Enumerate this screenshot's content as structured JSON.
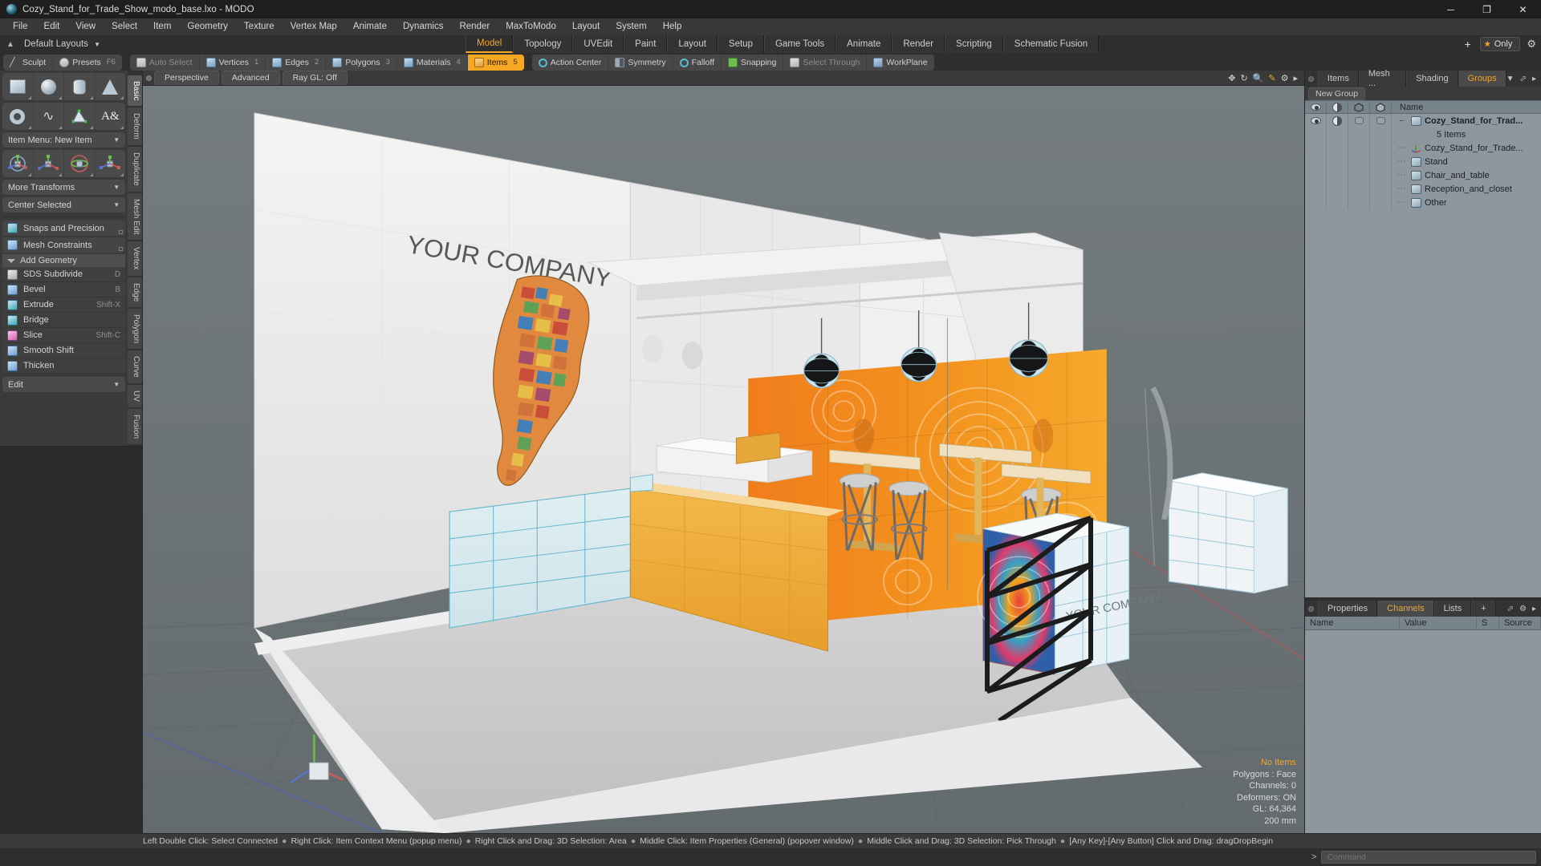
{
  "window": {
    "title": "Cozy_Stand_for_Trade_Show_modo_base.lxo - MODO",
    "app_icon": "modo-icon",
    "controls": {
      "minimize": "─",
      "maximize": "❐",
      "close": "✕"
    }
  },
  "menubar": {
    "items": [
      "File",
      "Edit",
      "View",
      "Select",
      "Item",
      "Geometry",
      "Texture",
      "Vertex Map",
      "Animate",
      "Dynamics",
      "Render",
      "MaxToModo",
      "Layout",
      "System",
      "Help"
    ]
  },
  "layoutbar": {
    "default_layouts": "Default Layouts",
    "tabs": [
      {
        "label": "Model",
        "active": true
      },
      {
        "label": "Topology",
        "active": false
      },
      {
        "label": "UVEdit",
        "active": false
      },
      {
        "label": "Paint",
        "active": false
      },
      {
        "label": "Layout",
        "active": false
      },
      {
        "label": "Setup",
        "active": false
      },
      {
        "label": "Game Tools",
        "active": false
      },
      {
        "label": "Animate",
        "active": false
      },
      {
        "label": "Render",
        "active": false
      },
      {
        "label": "Scripting",
        "active": false
      },
      {
        "label": "Schematic Fusion",
        "active": false
      }
    ],
    "add_tab": "+",
    "only_label": "Only",
    "gear": "gear-icon"
  },
  "modestrip": {
    "group_left": [
      {
        "label": "Sculpt",
        "key": "",
        "icon": "brush-icon",
        "dim": false,
        "active": false
      },
      {
        "label": "Presets",
        "key": "F6",
        "icon": "presets-icon",
        "dim": false,
        "active": false
      }
    ],
    "group_select": [
      {
        "label": "Auto Select",
        "key": "",
        "icon": "cube-gray-icon",
        "dim": true,
        "active": false
      },
      {
        "label": "Vertices",
        "key": "1",
        "icon": "cube-vertex-icon",
        "dim": false,
        "active": false
      },
      {
        "label": "Edges",
        "key": "2",
        "icon": "cube-edge-icon",
        "dim": false,
        "active": false
      },
      {
        "label": "Polygons",
        "key": "3",
        "icon": "cube-poly-icon",
        "dim": false,
        "active": false
      },
      {
        "label": "Materials",
        "key": "4",
        "icon": "cube-material-icon",
        "dim": false,
        "active": false
      },
      {
        "label": "Items",
        "key": "5",
        "icon": "cube-item-icon",
        "dim": false,
        "active": true
      }
    ],
    "group_right": [
      {
        "label": "Action Center",
        "key": "",
        "icon": "action-center-icon",
        "dim": false,
        "active": false
      },
      {
        "label": "Symmetry",
        "key": "",
        "icon": "symmetry-icon",
        "dim": false,
        "active": false
      },
      {
        "label": "Falloff",
        "key": "",
        "icon": "falloff-icon",
        "dim": false,
        "active": false
      },
      {
        "label": "Snapping",
        "key": "",
        "icon": "snapping-icon",
        "dim": false,
        "active": false
      },
      {
        "label": "Select Through",
        "key": "",
        "icon": "select-through-icon",
        "dim": true,
        "active": false
      },
      {
        "label": "WorkPlane",
        "key": "",
        "icon": "workplane-icon",
        "dim": false,
        "active": false
      }
    ]
  },
  "left_panel": {
    "vertical_tabs": [
      {
        "label": "Basic",
        "active": true
      },
      {
        "label": "Deform",
        "active": false
      },
      {
        "label": "Duplicate",
        "active": false
      },
      {
        "label": "Mesh Edit",
        "active": false
      },
      {
        "label": "Vertex",
        "active": false
      },
      {
        "label": "Edge",
        "active": false
      },
      {
        "label": "Polygon",
        "active": false
      },
      {
        "label": "Curve",
        "active": false
      },
      {
        "label": "UV",
        "active": false
      },
      {
        "label": "Fusion",
        "active": false
      }
    ],
    "primitives_row1": [
      "cube-tool",
      "sphere-tool",
      "cylinder-tool",
      "cone-tool"
    ],
    "primitives_row2": [
      "torus-tool",
      "curve-tool",
      "polygon-tool",
      "text-tool"
    ],
    "item_menu": "Item Menu: New Item",
    "transform_tools": [
      "transform-tool",
      "move-tool",
      "rotate-tool",
      "scale-tool"
    ],
    "more_transforms": "More Transforms",
    "center_selected": "Center Selected",
    "snaps_precision": "Snaps and Precision",
    "mesh_constraints": "Mesh Constraints",
    "add_geometry_header": "Add Geometry",
    "geometry_items": [
      {
        "label": "SDS Subdivide",
        "hotkey": "D",
        "icon": "sds-subdivide-icon"
      },
      {
        "label": "Bevel",
        "hotkey": "B",
        "icon": "bevel-icon"
      },
      {
        "label": "Extrude",
        "hotkey": "Shift-X",
        "icon": "extrude-icon"
      },
      {
        "label": "Bridge",
        "hotkey": "",
        "icon": "bridge-icon"
      },
      {
        "label": "Slice",
        "hotkey": "Shift-C",
        "icon": "slice-icon"
      },
      {
        "label": "Smooth Shift",
        "hotkey": "",
        "icon": "smooth-shift-icon"
      },
      {
        "label": "Thicken",
        "hotkey": "",
        "icon": "thicken-icon"
      }
    ],
    "edit_dropdown": "Edit"
  },
  "viewport": {
    "header": {
      "perspective": "Perspective",
      "advanced": "Advanced",
      "raygl": "Ray GL: Off",
      "icons": [
        "move-view-icon",
        "rotate-view-icon",
        "zoom-view-icon",
        "edit-view-icon",
        "gear-icon",
        "arrow-icon"
      ]
    },
    "stats": {
      "selection": "No Items",
      "polygons": "Polygons : Face",
      "channels": "Channels: 0",
      "deformers": "Deformers: ON",
      "gl": "GL: 64,364",
      "grid": "200 mm"
    },
    "scene": {
      "banner_text": "YOUR COMPANY",
      "kiosk_text": "YOUR COMPANY",
      "description": "3D trade show booth: white back wall with YOUR COMPANY sign and world-map graphic, orange patterned accent wall, three hanging disco pendant lamps, wooden bar counter, three bar tables with stools, colorful display kiosk, zigzag brochure stand, white closet units on grey floor"
    }
  },
  "right_panel": {
    "tabs": [
      {
        "label": "Items",
        "active": false
      },
      {
        "label": "Mesh ...",
        "active": false
      },
      {
        "label": "Shading",
        "active": false
      },
      {
        "label": "Groups",
        "active": true
      }
    ],
    "new_group_button": "New Group",
    "tree_headers": {
      "visible": "eye-icon",
      "shade": "shade-icon",
      "render": "render-icon",
      "lock": "lock-icon",
      "name": "Name"
    },
    "tree": [
      {
        "name": "Cozy_Stand_for_Trad...",
        "subtitle": "5 Items",
        "icon": "group-icon",
        "depth": 0,
        "selected": true
      },
      {
        "name": "Cozy_Stand_for_Trade...",
        "icon": "locator-icon",
        "depth": 1,
        "selected": false
      },
      {
        "name": "Stand",
        "icon": "mesh-icon",
        "depth": 1,
        "selected": false
      },
      {
        "name": "Chair_and_table",
        "icon": "mesh-icon",
        "depth": 1,
        "selected": false
      },
      {
        "name": "Reception_and_closet",
        "icon": "mesh-icon",
        "depth": 1,
        "selected": false
      },
      {
        "name": "Other",
        "icon": "mesh-icon",
        "depth": 1,
        "selected": false
      }
    ],
    "lower_tabs": [
      {
        "label": "Properties",
        "active": false
      },
      {
        "label": "Channels",
        "active": true
      },
      {
        "label": "Lists",
        "active": false
      }
    ],
    "lower_add": "+",
    "channel_headers": [
      "Name",
      "Value",
      "S",
      "Source"
    ]
  },
  "statusbar": {
    "hints": [
      "Left Double Click: Select Connected",
      "Right Click: Item Context Menu (popup menu)",
      "Right Click and Drag: 3D Selection: Area",
      "Middle Click: Item Properties (General) (popover window)",
      "Middle Click and Drag: 3D Selection: Pick Through",
      "[Any Key]-[Any Button] Click and Drag: dragDropBegin"
    ]
  },
  "commandbar": {
    "prompt": ">",
    "placeholder": "Command"
  },
  "colors": {
    "accent": "#f5a623",
    "panel": "#3a3a3a",
    "tree_bg": "#8d979d",
    "viewport_bg": "#6c7377"
  }
}
